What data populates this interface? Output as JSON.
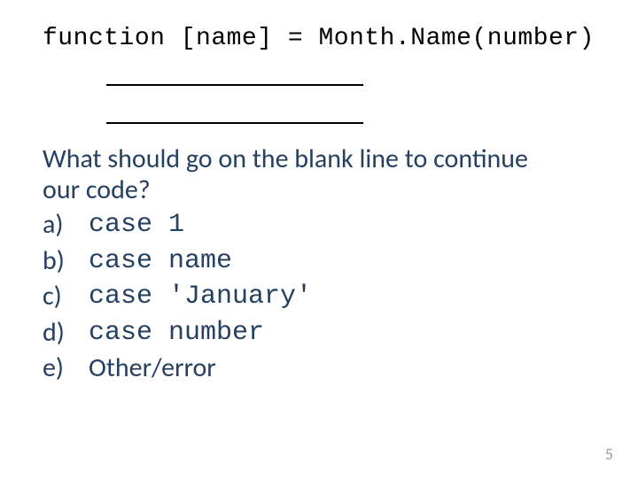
{
  "code": {
    "line1": "function [name] = Month.Name(number)"
  },
  "question_line1": "What should go on the blank line to continue",
  "question_line2": "our code?",
  "options": {
    "a": {
      "label": "a)",
      "code": "case 1"
    },
    "b": {
      "label": "b)",
      "code": "case name"
    },
    "c": {
      "label": "c)",
      "code": "case 'January'"
    },
    "d": {
      "label": "d)",
      "code": "case number"
    },
    "e": {
      "label": "e)",
      "text": "Other/error"
    }
  },
  "page_number": "5"
}
